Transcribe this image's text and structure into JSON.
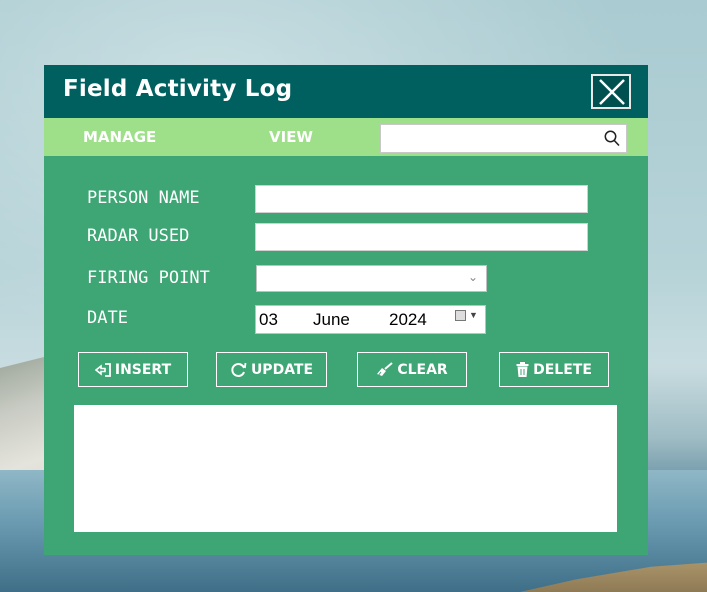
{
  "window": {
    "title": "Field Activity Log",
    "close_icon": "close-icon"
  },
  "menu": {
    "manage_label": "MANAGE",
    "view_label": "VIEW",
    "search_value": "",
    "search_icon": "search-icon"
  },
  "form": {
    "person_name_label": "PERSON NAME",
    "person_name_value": "",
    "radar_used_label": "RADAR USED",
    "radar_used_value": "",
    "firing_point_label": "FIRING POINT",
    "firing_point_value": "",
    "date_label": "DATE",
    "date_day": "03",
    "date_month": "June",
    "date_year": "2024"
  },
  "buttons": {
    "insert_label": "INSERT",
    "update_label": "UPDATE",
    "clear_label": "CLEAR",
    "delete_label": "DELETE"
  },
  "colors": {
    "titlebar": "#005f5f",
    "menubar": "#9ee08a",
    "body": "#3ea574"
  }
}
